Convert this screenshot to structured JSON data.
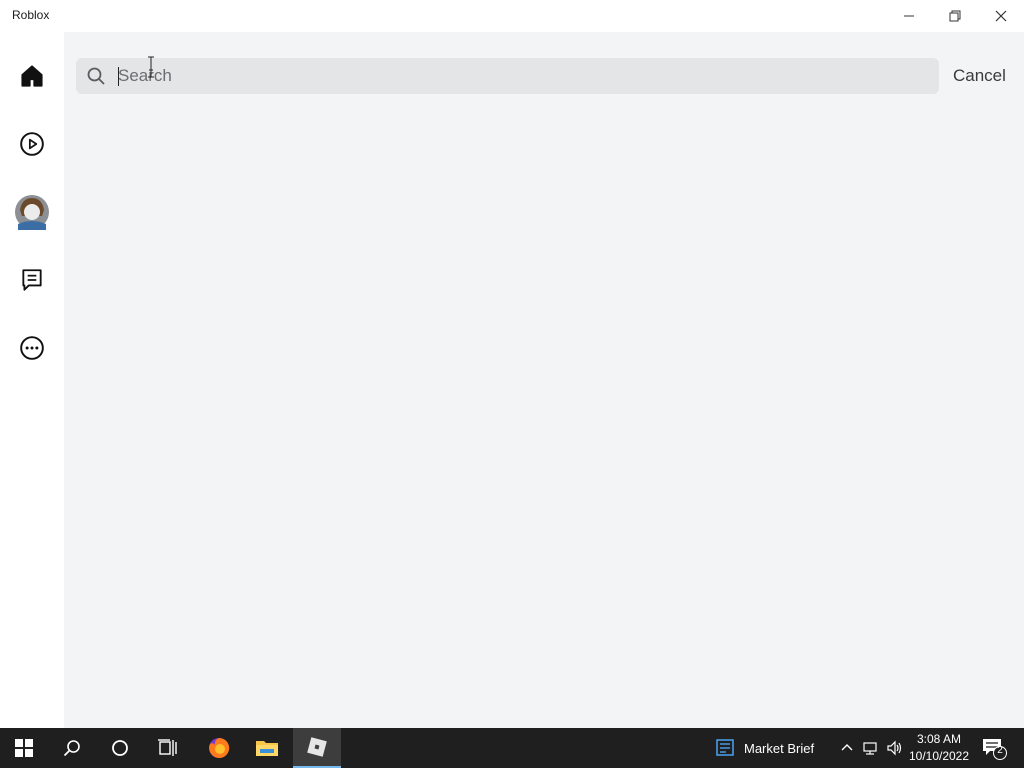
{
  "window": {
    "title": "Roblox"
  },
  "sidebar": {
    "items": [
      {
        "name": "home",
        "icon": "home-icon"
      },
      {
        "name": "discover",
        "icon": "play-circle-icon"
      },
      {
        "name": "avatar",
        "icon": "avatar-icon"
      },
      {
        "name": "chat",
        "icon": "chat-icon"
      },
      {
        "name": "more",
        "icon": "more-icon"
      }
    ]
  },
  "search": {
    "placeholder": "Search",
    "value": "",
    "cancel_label": "Cancel"
  },
  "taskbar": {
    "apps": [
      {
        "name": "start",
        "icon": "windows-logo-icon"
      },
      {
        "name": "search",
        "icon": "search-icon"
      },
      {
        "name": "cortana",
        "icon": "cortana-circle-icon"
      },
      {
        "name": "task-view",
        "icon": "task-view-icon"
      },
      {
        "name": "firefox",
        "icon": "firefox-icon"
      },
      {
        "name": "file-explorer",
        "icon": "folder-icon"
      },
      {
        "name": "roblox",
        "icon": "roblox-icon",
        "active": true
      }
    ],
    "news_label": "Market Brief",
    "clock": {
      "time": "3:08 AM",
      "date": "10/10/2022"
    },
    "notification_count": "2"
  },
  "colors": {
    "content_bg": "#f2f4f5",
    "search_bg": "#e3e5e6",
    "taskbar_bg": "#1f1f1f",
    "active_accent": "#76b9ed"
  }
}
